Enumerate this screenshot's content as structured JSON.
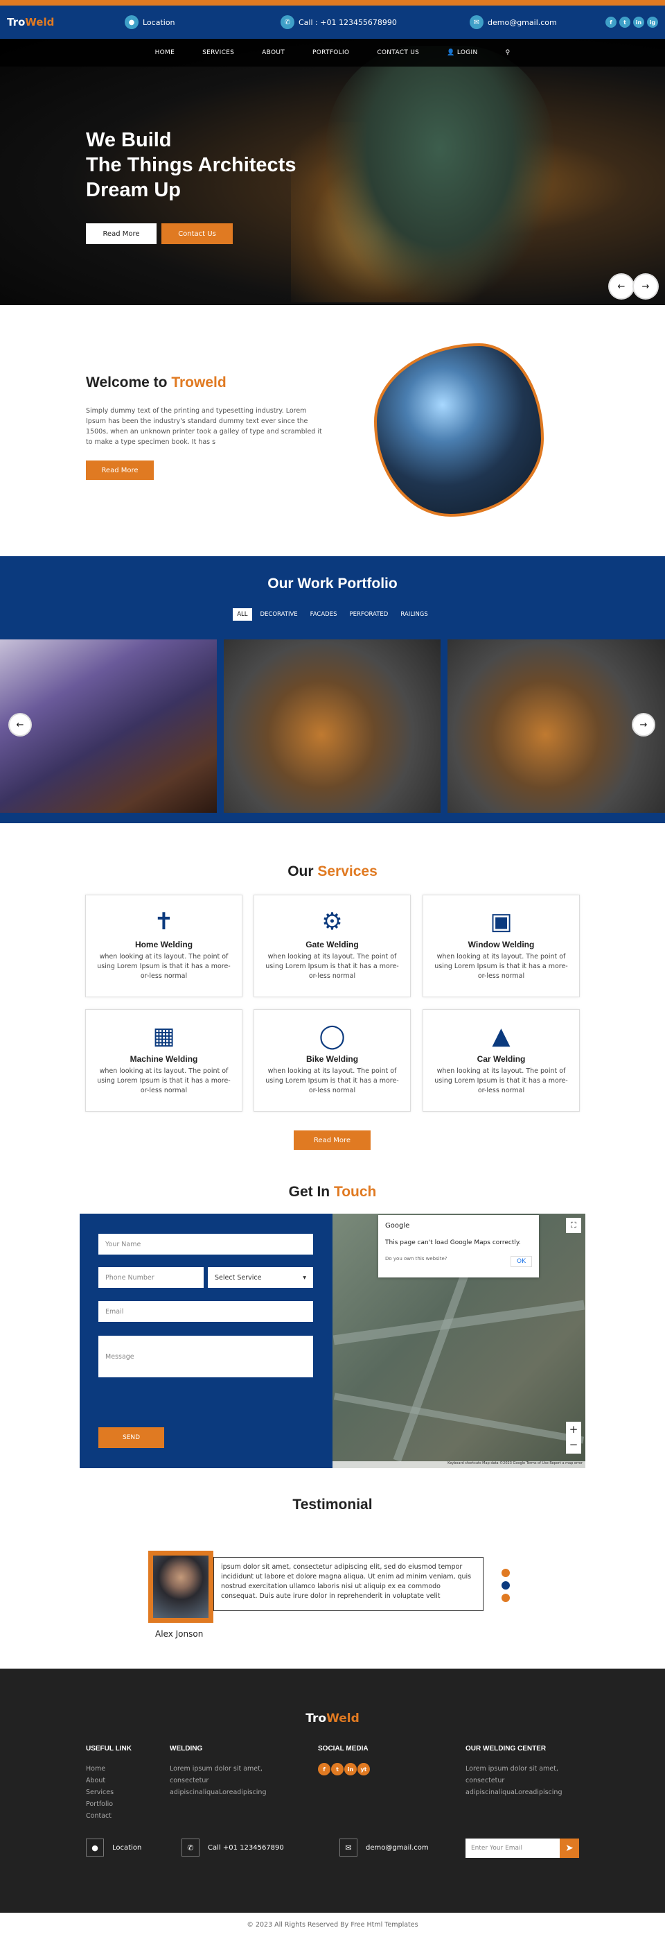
{
  "brand": {
    "part1": "Tro",
    "part2": "Weld"
  },
  "topbar": {
    "location": "Location",
    "phone": "Call : +01 123455678990",
    "email": "demo@gmail.com",
    "social": [
      "f",
      "t",
      "in",
      "ig"
    ]
  },
  "nav": [
    "HOME",
    "SERVICES",
    "ABOUT",
    "PORTFOLIO",
    "CONTACT US"
  ],
  "nav_login": "LOGIN",
  "hero": {
    "line1": "We Build",
    "line2": "The Things Architects",
    "line3": "Dream Up",
    "btn_read": "Read More",
    "btn_contact": "Contact Us"
  },
  "welcome": {
    "title_a": "Welcome to ",
    "title_b": "Troweld",
    "text": "Simply dummy text of the printing and typesetting industry. Lorem Ipsum has been the industry's standard dummy text ever since the 1500s, when an unknown printer took a galley of type and scrambled it to make a type specimen book. It has s",
    "btn": "Read More"
  },
  "portfolio": {
    "title": "Our Work Portfolio",
    "filters": [
      "ALL",
      "DECORATIVE",
      "FACADES",
      "PERFORATED",
      "RAILINGS"
    ]
  },
  "services": {
    "title_a": "Our ",
    "title_b": "Services",
    "items": [
      {
        "name": "Home Welding",
        "text": "when looking at its layout. The point of using Lorem Ipsum is that it has a more-or-less normal"
      },
      {
        "name": "Gate Welding",
        "text": "when looking at its layout. The point of using Lorem Ipsum is that it has a more-or-less normal"
      },
      {
        "name": "Window Welding",
        "text": "when looking at its layout. The point of using Lorem Ipsum is that it has a more-or-less normal"
      },
      {
        "name": "Machine Welding",
        "text": "when looking at its layout. The point of using Lorem Ipsum is that it has a more-or-less normal"
      },
      {
        "name": "Bike Welding",
        "text": "when looking at its layout. The point of using Lorem Ipsum is that it has a more-or-less normal"
      },
      {
        "name": "Car Welding",
        "text": "when looking at its layout. The point of using Lorem Ipsum is that it has a more-or-less normal"
      }
    ],
    "btn": "Read More"
  },
  "contact": {
    "title_a": "Get In ",
    "title_b": "Touch",
    "name_ph": "Your Name",
    "phone_ph": "Phone Number",
    "service_ph": "Select Service",
    "email_ph": "Email",
    "message_ph": "Message",
    "send": "SEND",
    "map_google": "Google",
    "map_msg": "This page can't load Google Maps correctly.",
    "map_q": "Do you own this website?",
    "map_ok": "OK",
    "map_footer": "Keyboard shortcuts  Map data ©2023 Google  Terms of Use  Report a map error"
  },
  "testimonial": {
    "title": "Testimonial",
    "text": "ipsum dolor sit amet, consectetur adipiscing elit, sed do eiusmod tempor incididunt ut labore et dolore magna aliqua. Ut enim ad minim veniam, quis nostrud exercitation ullamco laboris nisi ut aliquip ex ea commodo consequat. Duis aute irure dolor in reprehenderit in voluptate velit",
    "name": "Alex Jonson"
  },
  "footer": {
    "useful_title": "USEFUL LINK",
    "links": [
      "Home",
      "About",
      "Services",
      "Portfolio",
      "Contact"
    ],
    "welding_title": "WELDING",
    "welding_text": "Lorem ipsum dolor sit amet, consectetur adipiscinaliquaLoreadipiscing",
    "social_title": "SOCIAL MEDIA",
    "social": [
      "f",
      "t",
      "in",
      "yt"
    ],
    "center_title": "OUR WELDING CENTER",
    "center_text": "Lorem ipsum dolor sit amet, consectetur adipiscinaliquaLoreadipiscing",
    "location": "Location",
    "phone": "Call +01 1234567890",
    "email": "demo@gmail.com",
    "email_ph": "Enter Your Email",
    "copyright": "© 2023 All Rights Reserved By Free Html Templates"
  },
  "colors": {
    "primary": "#0b3a7e",
    "accent": "#e07a22",
    "footer": "#222222"
  }
}
